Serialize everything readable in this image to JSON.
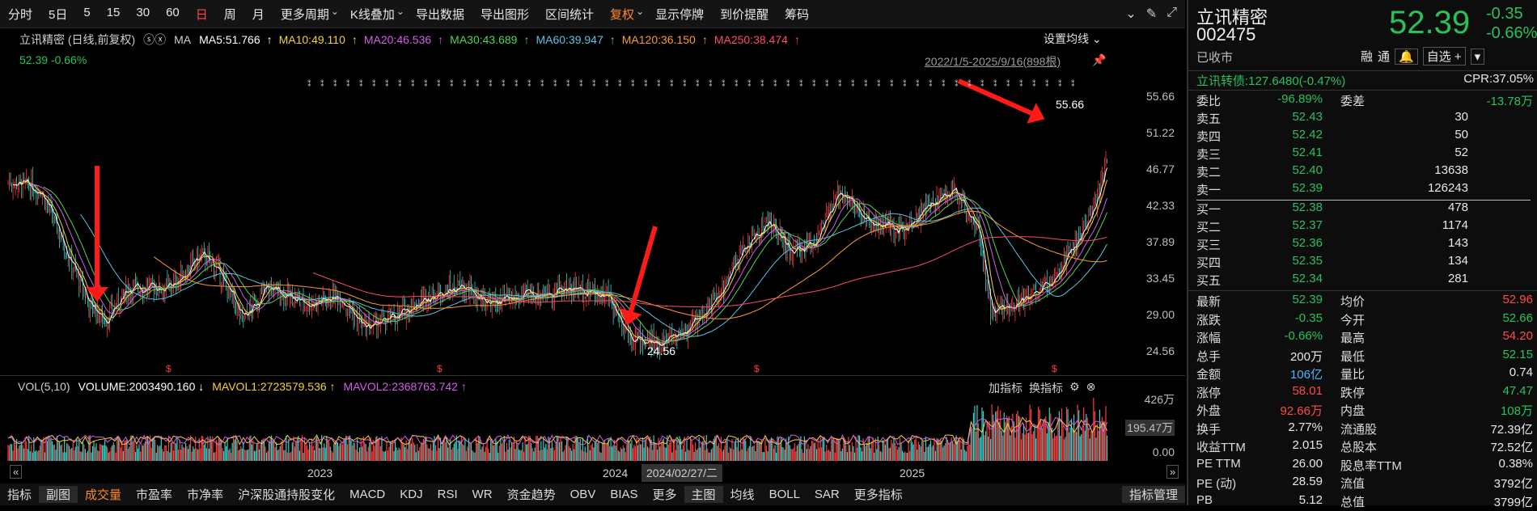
{
  "toolbar": {
    "items": [
      "分时",
      "5日",
      "5",
      "15",
      "30",
      "60",
      "日",
      "周",
      "月",
      "更多周期",
      "K线叠加",
      "导出数据",
      "导出图形",
      "区间统计",
      "复权",
      "显示停牌",
      "到价提醒",
      "筹码"
    ]
  },
  "chart": {
    "legend_prefix": "立讯精密 (日线,前复权)",
    "ma_label": "MA",
    "ma": [
      {
        "label": "MA5:51.766",
        "color": "#ffffff"
      },
      {
        "label": "MA10:49.110",
        "color": "#f5d130"
      },
      {
        "label": "MA20:46.536",
        "color": "#d35ee8"
      },
      {
        "label": "MA30:43.689",
        "color": "#4ed64e"
      },
      {
        "label": "MA60:39.947",
        "color": "#57c4e6"
      },
      {
        "label": "MA120:36.150",
        "color": "#ff9a2a"
      },
      {
        "label": "MA250:38.474",
        "color": "#ff4a6a"
      }
    ],
    "price_line": "52.39 -0.66%",
    "set_ma": "设置均线",
    "date_range": "2022/1/5-2025/9/16(898根)",
    "high_label": "55.66",
    "low_label": "24.56",
    "y_ticks": [
      "55.66",
      "51.22",
      "46.77",
      "42.33",
      "37.89",
      "33.45",
      "29.00",
      "24.56"
    ],
    "x_ticks": [
      "2023",
      "2024",
      "2025"
    ],
    "cursor_date": "2024/02/27/二"
  },
  "volume": {
    "label": "VOL(5,10)",
    "volume": "VOLUME:2003490.160",
    "mavol1": "MAVOL1:2723579.536",
    "mavol2": "MAVOL2:2368763.742",
    "tools": [
      "加指标",
      "换指标"
    ],
    "y_ticks": [
      "426万",
      "195.47万",
      "0.00"
    ]
  },
  "bottom_tabs": [
    "指标",
    "副图",
    "成交量",
    "市盈率",
    "市净率",
    "沪深股通持股变化",
    "MACD",
    "KDJ",
    "RSI",
    "WR",
    "资金趋势",
    "OBV",
    "BIAS",
    "更多",
    "主图",
    "均线",
    "BOLL",
    "SAR",
    "更多指标",
    "指标管理"
  ],
  "right": {
    "name": "立讯精密",
    "code": "002475",
    "status": "已收市",
    "price": "52.39",
    "chg": "-0.35",
    "chg_pct": "-0.66%",
    "buttons": [
      "融",
      "通",
      "自选 +"
    ],
    "cb_line": "立讯转债:127.6480(-0.47%)",
    "cpr": "CPR:37.05%",
    "weibi": {
      "l": "委比",
      "v": "-96.89%",
      "l2": "委差",
      "v2": "-13.78万"
    },
    "asks": [
      {
        "l": "卖五",
        "p": "52.43",
        "q": "30"
      },
      {
        "l": "卖四",
        "p": "52.42",
        "q": "50"
      },
      {
        "l": "卖三",
        "p": "52.41",
        "q": "52"
      },
      {
        "l": "卖二",
        "p": "52.40",
        "q": "13638"
      },
      {
        "l": "卖一",
        "p": "52.39",
        "q": "126243"
      }
    ],
    "bids": [
      {
        "l": "买一",
        "p": "52.38",
        "q": "478"
      },
      {
        "l": "买二",
        "p": "52.37",
        "q": "1174"
      },
      {
        "l": "买三",
        "p": "52.36",
        "q": "143"
      },
      {
        "l": "买四",
        "p": "52.35",
        "q": "134"
      },
      {
        "l": "买五",
        "p": "52.34",
        "q": "281"
      }
    ],
    "stats": [
      {
        "l": "最新",
        "v": "52.39",
        "c1": "g",
        "l2": "均价",
        "v2": "52.96",
        "c2": "r"
      },
      {
        "l": "涨跌",
        "v": "-0.35",
        "c1": "g",
        "l2": "今开",
        "v2": "52.66",
        "c2": "g"
      },
      {
        "l": "涨幅",
        "v": "-0.66%",
        "c1": "g",
        "l2": "最高",
        "v2": "54.20",
        "c2": "r"
      },
      {
        "l": "总手",
        "v": "200万",
        "c1": "w",
        "l2": "最低",
        "v2": "52.15",
        "c2": "g"
      },
      {
        "l": "金额",
        "v": "106亿",
        "c1": "c",
        "l2": "量比",
        "v2": "0.74",
        "c2": "w"
      },
      {
        "l": "涨停",
        "v": "58.01",
        "c1": "r",
        "l2": "跌停",
        "v2": "47.47",
        "c2": "g"
      },
      {
        "l": "外盘",
        "v": "92.66万",
        "c1": "r",
        "l2": "内盘",
        "v2": "108万",
        "c2": "g"
      },
      {
        "l": "换手",
        "v": "2.77%",
        "c1": "w",
        "l2": "流通股",
        "v2": "72.39亿",
        "c2": "w"
      },
      {
        "l": "收益TTM",
        "v": "2.015",
        "c1": "w",
        "l2": "总股本",
        "v2": "72.52亿",
        "c2": "w"
      },
      {
        "l": "PE TTM",
        "v": "26.00",
        "c1": "w",
        "l2": "股息率TTM",
        "v2": "0.38%",
        "c2": "w"
      },
      {
        "l": "PE (动)",
        "v": "28.59",
        "c1": "w",
        "l2": "流值",
        "v2": "3792亿",
        "c2": "w"
      },
      {
        "l": "PB",
        "v": "5.12",
        "c1": "w",
        "l2": "总值",
        "v2": "3799亿",
        "c2": "w"
      }
    ]
  }
}
